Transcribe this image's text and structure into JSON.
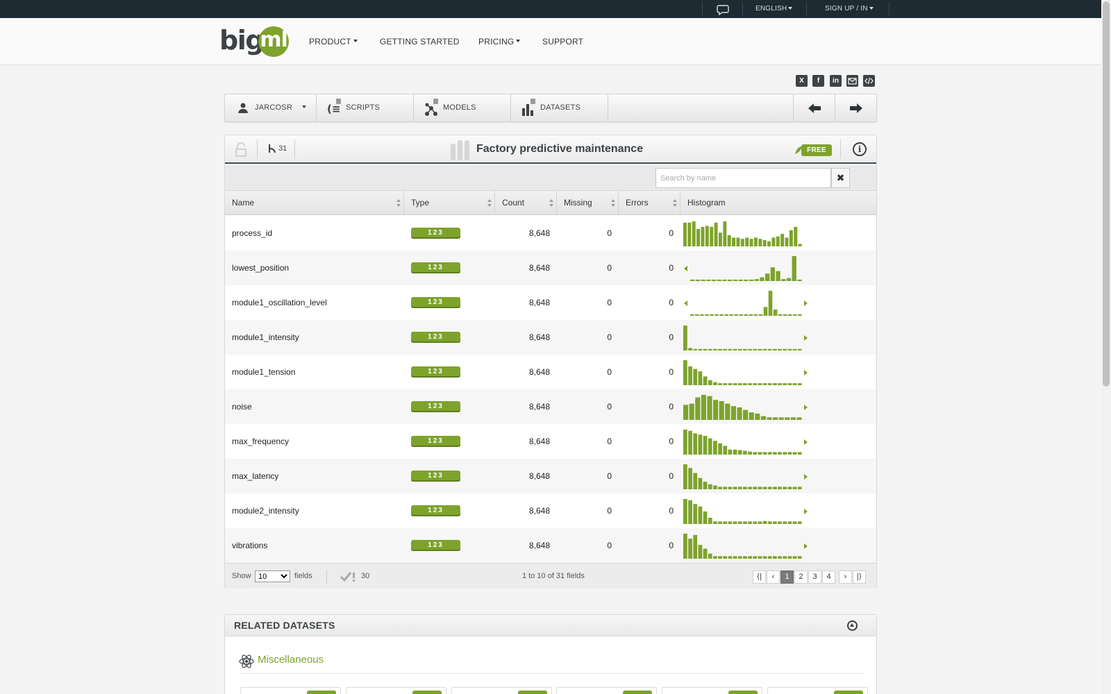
{
  "topbar": {
    "language": "ENGLISH",
    "signup": "SIGN UP / IN"
  },
  "header": {
    "logo_big": "big",
    "logo_ml": "ml",
    "nav": [
      {
        "label": "PRODUCT",
        "dropdown": true
      },
      {
        "label": "GETTING STARTED",
        "dropdown": false
      },
      {
        "label": "PRICING",
        "dropdown": true
      },
      {
        "label": "SUPPORT",
        "dropdown": false
      }
    ]
  },
  "social": [
    "x-icon",
    "facebook-icon",
    "linkedin-icon",
    "email-icon",
    "embed-code-icon"
  ],
  "toolbar": {
    "user": "JARCOSR",
    "scripts": "SCRIPTS",
    "models": "MODELS",
    "datasets": "DATASETS"
  },
  "dataset": {
    "field_count_badge": "31",
    "title": "Factory predictive maintenance",
    "price_tag": "FREE",
    "info_icon": "i"
  },
  "search": {
    "placeholder": "Search by name",
    "value": ""
  },
  "table": {
    "headers": [
      "Name",
      "Type",
      "Count",
      "Missing",
      "Errors",
      "Histogram"
    ],
    "type_badge": "123",
    "rows": [
      {
        "name": "process_id",
        "count": "8,648",
        "missing": "0",
        "errors": "0",
        "left_arrow": false,
        "right_arrow": false,
        "hist": [
          0.95,
          0.95,
          1.0,
          0.7,
          0.78,
          0.82,
          0.78,
          0.95,
          0.55,
          1.0,
          0.45,
          0.35,
          0.35,
          0.3,
          0.35,
          0.3,
          0.35,
          0.3,
          0.25,
          0.2,
          0.35,
          0.4,
          0.5,
          0.35,
          0.65,
          0.78,
          0.1
        ]
      },
      {
        "name": "lowest_position",
        "count": "8,648",
        "missing": "0",
        "errors": "0",
        "left_arrow": true,
        "right_arrow": false,
        "hist": [
          0.06,
          0.06,
          0.06,
          0.06,
          0.06,
          0.06,
          0.06,
          0.06,
          0.06,
          0.06,
          0.06,
          0.06,
          0.08,
          0.15,
          0.3,
          0.55,
          0.4,
          0.08,
          0.12,
          1.0,
          0.06
        ]
      },
      {
        "name": "module1_oscillation_level",
        "count": "8,648",
        "missing": "0",
        "errors": "0",
        "left_arrow": true,
        "right_arrow": true,
        "hist": [
          0.06,
          0.06,
          0.06,
          0.06,
          0.06,
          0.06,
          0.06,
          0.06,
          0.06,
          0.06,
          0.06,
          0.06,
          0.06,
          0.06,
          0.06,
          0.35,
          1.0,
          0.25,
          0.06,
          0.06,
          0.06,
          0.06,
          0.06
        ]
      },
      {
        "name": "module1_intensity",
        "count": "8,648",
        "missing": "0",
        "errors": "0",
        "left_arrow": false,
        "right_arrow": true,
        "hist": [
          1.0,
          0.1,
          0.06,
          0.06,
          0.06,
          0.06,
          0.06,
          0.06,
          0.06,
          0.06,
          0.06,
          0.06,
          0.06,
          0.06,
          0.06,
          0.06,
          0.06,
          0.06,
          0.06,
          0.06,
          0.06,
          0.06,
          0.06,
          0.06
        ]
      },
      {
        "name": "module1_tension",
        "count": "8,648",
        "missing": "0",
        "errors": "0",
        "left_arrow": false,
        "right_arrow": true,
        "hist": [
          1.0,
          0.75,
          0.65,
          0.55,
          0.35,
          0.2,
          0.12,
          0.08,
          0.08,
          0.08,
          0.08,
          0.08,
          0.08,
          0.08,
          0.08,
          0.08,
          0.08,
          0.08,
          0.08,
          0.08,
          0.08,
          0.08,
          0.08,
          0.08
        ]
      },
      {
        "name": "noise",
        "count": "8,648",
        "missing": "0",
        "errors": "0",
        "left_arrow": false,
        "right_arrow": true,
        "hist": [
          0.6,
          0.65,
          0.9,
          1.0,
          0.95,
          0.8,
          0.75,
          0.65,
          0.55,
          0.5,
          0.4,
          0.3,
          0.25,
          0.15,
          0.1,
          0.1,
          0.1,
          0.1,
          0.1,
          0.1
        ]
      },
      {
        "name": "max_frequency",
        "count": "8,648",
        "missing": "0",
        "errors": "0",
        "left_arrow": false,
        "right_arrow": true,
        "hist": [
          1.0,
          0.95,
          0.85,
          0.8,
          0.75,
          0.65,
          0.55,
          0.45,
          0.35,
          0.2,
          0.2,
          0.18,
          0.15,
          0.12,
          0.1,
          0.1,
          0.1,
          0.1,
          0.1,
          0.1,
          0.1,
          0.1,
          0.1,
          0.1
        ]
      },
      {
        "name": "max_latency",
        "count": "8,648",
        "missing": "0",
        "errors": "0",
        "left_arrow": false,
        "right_arrow": true,
        "hist": [
          1.0,
          0.85,
          0.65,
          0.45,
          0.3,
          0.2,
          0.15,
          0.1,
          0.1,
          0.1,
          0.1,
          0.1,
          0.1,
          0.1,
          0.1,
          0.1,
          0.1,
          0.1,
          0.1,
          0.1,
          0.1,
          0.1,
          0.1,
          0.1
        ]
      },
      {
        "name": "module2_intensity",
        "count": "8,648",
        "missing": "0",
        "errors": "0",
        "left_arrow": false,
        "right_arrow": true,
        "hist": [
          1.0,
          0.95,
          0.8,
          0.7,
          0.5,
          0.25,
          0.1,
          0.1,
          0.1,
          0.1,
          0.1,
          0.1,
          0.1,
          0.1,
          0.1,
          0.1,
          0.12,
          0.1,
          0.1,
          0.1,
          0.1,
          0.1,
          0.1,
          0.1
        ]
      },
      {
        "name": "vibrations",
        "count": "8,648",
        "missing": "0",
        "errors": "0",
        "left_arrow": false,
        "right_arrow": true,
        "hist": [
          1.0,
          0.8,
          0.95,
          0.55,
          0.4,
          0.2,
          0.1,
          0.1,
          0.1,
          0.1,
          0.1,
          0.1,
          0.1,
          0.1,
          0.1,
          0.1,
          0.1,
          0.1,
          0.1,
          0.1,
          0.1,
          0.1,
          0.1,
          0.1
        ]
      }
    ]
  },
  "footer": {
    "show_label": "Show",
    "show_value": "10",
    "show_options": [
      "10"
    ],
    "fields_label": "fields",
    "checked_count": "30",
    "range_text": "1 to 10 of 31 fields",
    "pages": [
      "1",
      "2",
      "3",
      "4"
    ],
    "current_page": "1"
  },
  "related": {
    "title": "RELATED DATASETS",
    "category": "Miscellaneous"
  },
  "colors": {
    "accent": "#7ea32c",
    "dark": "#1f2b33",
    "title_border": "#3a4a55"
  }
}
